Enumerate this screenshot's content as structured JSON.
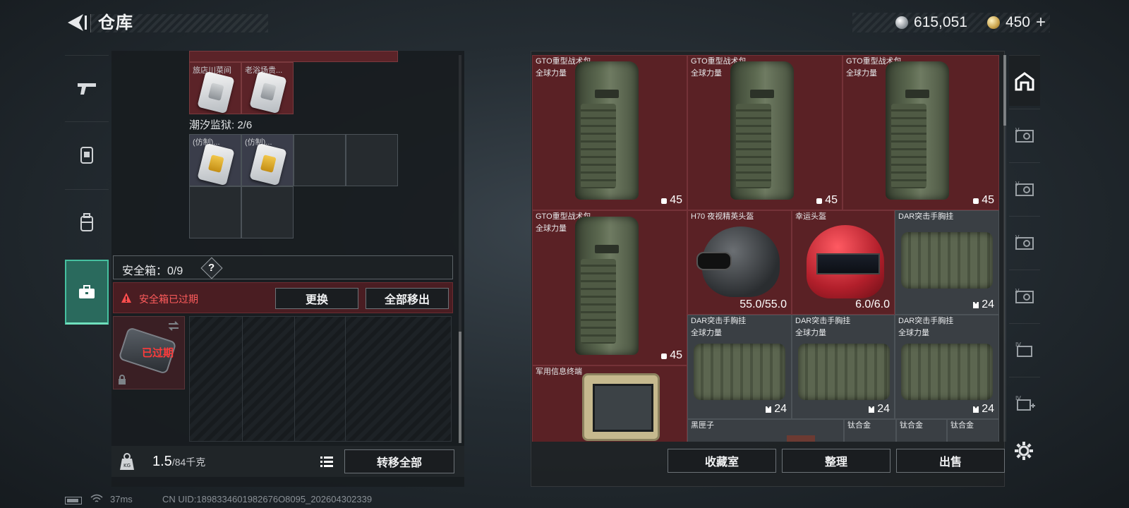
{
  "header": {
    "title": "仓库",
    "currency_silver": "615,051",
    "currency_gold": "450",
    "currency_plus": "+"
  },
  "left_nav": {
    "items": [
      {
        "name": "weapons"
      },
      {
        "name": "armor"
      },
      {
        "name": "backpack"
      },
      {
        "name": "safe-box",
        "active": true
      }
    ]
  },
  "keycards": {
    "top_labels": [
      "旅店川菜间",
      "老浴场贵..."
    ],
    "section_title": "潮汐监狱: 2/6",
    "prison_labels": [
      "(仿制)...",
      "(仿制)..."
    ]
  },
  "safe": {
    "title": "安全箱：0/9",
    "help": "?",
    "expired_text": "安全箱已过期",
    "replace_button": "更换",
    "remove_all_button": "全部移出",
    "box_status": "已过期"
  },
  "footer_left": {
    "weight_value": "1.5",
    "weight_capacity": "/84千克",
    "transfer_all_button": "转移全部"
  },
  "status": {
    "ping": "37ms",
    "uid": "CN UID:1898334601982676O8095_202604302339"
  },
  "stash": {
    "items": [
      {
        "name": "GTO重型战术包",
        "sub": "全球力量",
        "value": "45",
        "kind": "backpack"
      },
      {
        "name": "GTO重型战术包",
        "sub": "全球力量",
        "value": "45",
        "kind": "backpack"
      },
      {
        "name": "GTO重型战术包",
        "sub": "全球力量",
        "value": "45",
        "kind": "backpack"
      },
      {
        "name": "GTO重型战术包",
        "sub": "全球力量",
        "value": "45",
        "kind": "backpack"
      },
      {
        "name": "H70 夜视精英头盔",
        "sub": "",
        "value": "55.0/55.0",
        "kind": "helmet"
      },
      {
        "name": "幸运头盔",
        "sub": "",
        "value": "6.0/6.0",
        "kind": "helmet"
      },
      {
        "name": "DAR突击手胸挂",
        "sub": "",
        "value": "24",
        "kind": "rig"
      },
      {
        "name": "DAR突击手胸挂",
        "sub": "全球力量",
        "value": "24",
        "kind": "rig"
      },
      {
        "name": "DAR突击手胸挂",
        "sub": "全球力量",
        "value": "24",
        "kind": "rig"
      },
      {
        "name": "DAR突击手胸挂",
        "sub": "全球力量",
        "value": "24",
        "kind": "rig"
      },
      {
        "name": "军用信息终端",
        "sub": "",
        "value": "",
        "kind": "terminal"
      },
      {
        "name": "黑匣子",
        "sub": "",
        "value": "",
        "kind": "misc"
      },
      {
        "name": "钛合金",
        "sub": "",
        "value": "",
        "kind": "misc"
      },
      {
        "name": "钛合金",
        "sub": "",
        "value": "",
        "kind": "misc"
      },
      {
        "name": "钛合金",
        "sub": "",
        "value": "",
        "kind": "misc"
      }
    ]
  },
  "footer_right": {
    "collection_button": "收藏室",
    "sort_button": "整理",
    "sell_button": "出售"
  },
  "right_nav": {
    "items": [
      "home",
      "v-1",
      "v-2",
      "v-3",
      "v-4",
      "iv-1",
      "iv-add"
    ]
  }
}
